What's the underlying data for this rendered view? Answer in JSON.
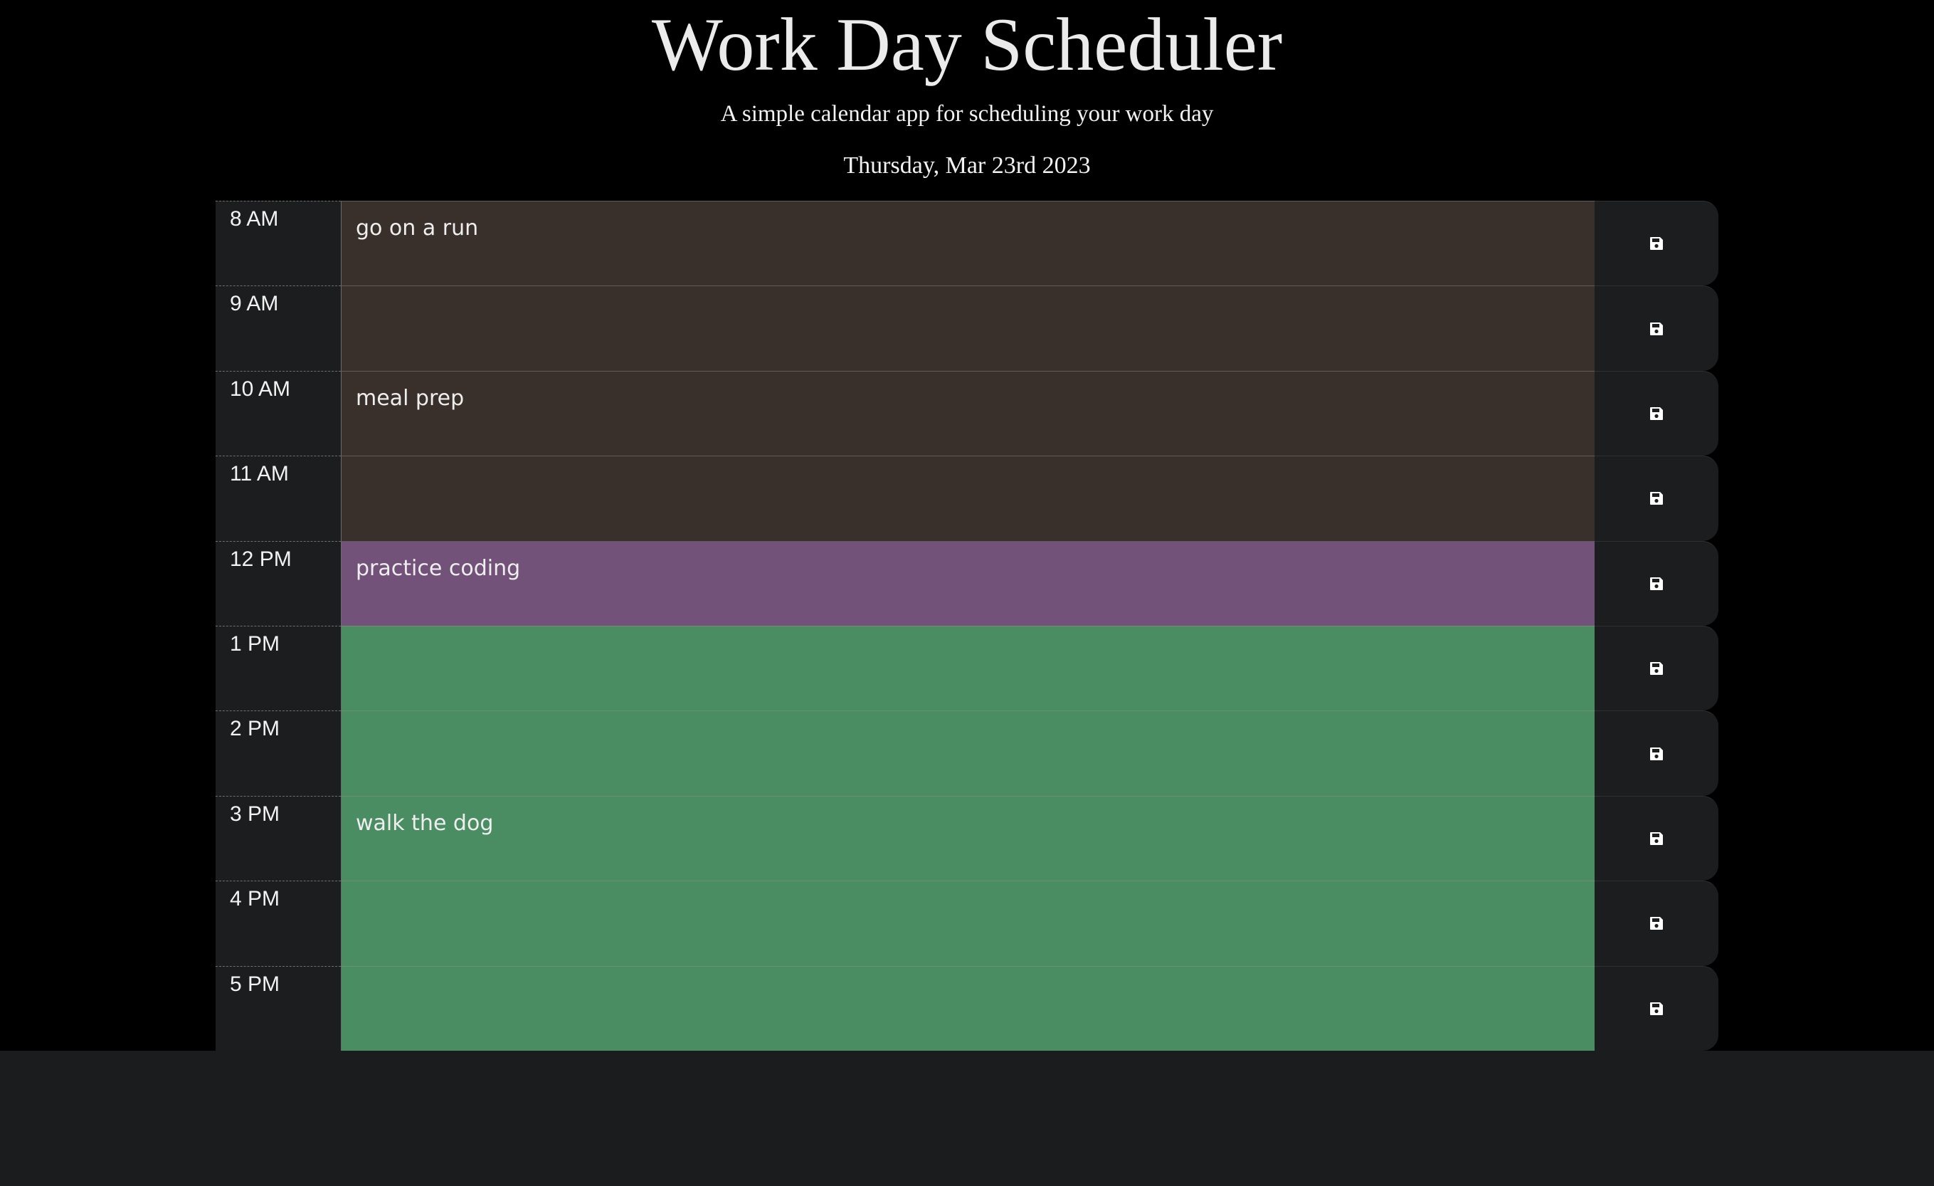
{
  "header": {
    "title": "Work Day Scheduler",
    "subtitle": "A simple calendar app for scheduling your work day",
    "current_day": "Thursday, Mar 23rd 2023"
  },
  "colors": {
    "past": "#3a302b",
    "present": "#725278",
    "future": "#4b8d63"
  },
  "timeblocks": [
    {
      "hour": "8 AM",
      "text": "go on a run",
      "state": "past",
      "save_icon": "floppy-disk-icon"
    },
    {
      "hour": "9 AM",
      "text": "",
      "state": "past",
      "save_icon": "floppy-disk-icon"
    },
    {
      "hour": "10 AM",
      "text": "meal prep",
      "state": "past",
      "save_icon": "floppy-disk-icon"
    },
    {
      "hour": "11 AM",
      "text": "",
      "state": "past",
      "save_icon": "floppy-disk-icon"
    },
    {
      "hour": "12 PM",
      "text": "practice coding",
      "state": "present",
      "save_icon": "floppy-disk-icon"
    },
    {
      "hour": "1 PM",
      "text": "",
      "state": "future",
      "save_icon": "floppy-disk-icon"
    },
    {
      "hour": "2 PM",
      "text": "",
      "state": "future",
      "save_icon": "floppy-disk-icon"
    },
    {
      "hour": "3 PM",
      "text": "walk the dog",
      "state": "future",
      "save_icon": "floppy-disk-icon"
    },
    {
      "hour": "4 PM",
      "text": "",
      "state": "future",
      "save_icon": "floppy-disk-icon"
    },
    {
      "hour": "5 PM",
      "text": "",
      "state": "future",
      "save_icon": "floppy-disk-icon"
    }
  ]
}
